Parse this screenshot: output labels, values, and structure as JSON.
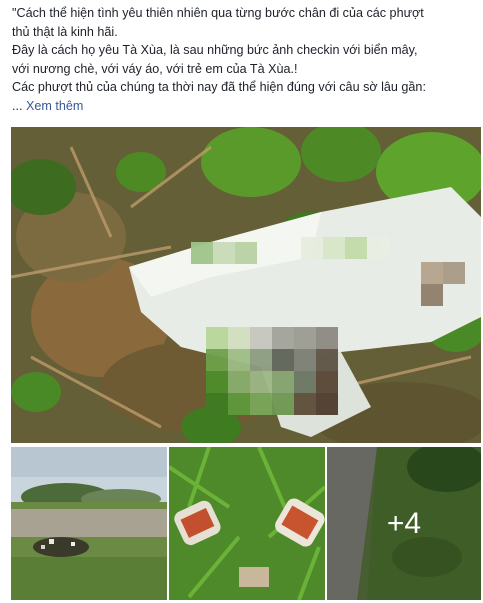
{
  "post": {
    "lines": [
      "\"Cách thể hiện tình yêu thiên nhiên qua từng bước chân đi của các phượt",
      "thủ thật là kinh hãi.",
      "Đây là cách họ yêu Tà Xùa, là sau những bức ảnh checkin với biển mây,",
      "với nương chè, với váy áo, với trẻ em của Tà Xùa.!",
      "Các phượt thủ của chúng ta thời nay đã thể hiện đúng với câu sờ lâu gần:"
    ],
    "ellipsis": "... ",
    "see_more": "Xem thêm"
  },
  "photos": {
    "more_count": "+4"
  },
  "colors": {
    "link": "#385898",
    "text": "#1d2129"
  }
}
